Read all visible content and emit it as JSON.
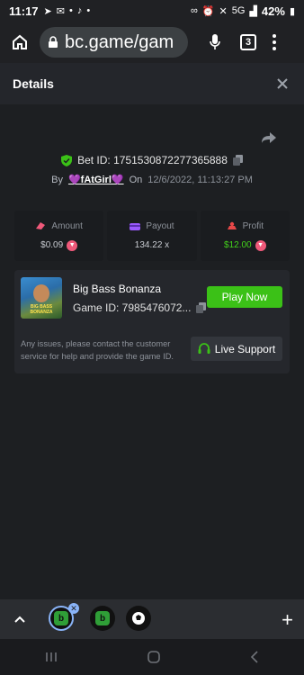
{
  "status": {
    "time": "11:17",
    "network": "5G",
    "battery": "42%"
  },
  "browser": {
    "url": "bc.game/gam",
    "tab_count": "3"
  },
  "details": {
    "title": "Details"
  },
  "bet": {
    "id_label": "Bet ID: 1751530872277365888",
    "by_label": "By",
    "user": "💜fAtGirl💜",
    "on_label": "On",
    "date": "12/6/2022, 11:13:27 PM"
  },
  "stats": {
    "amount_label": "Amount",
    "amount_value": "$0.09",
    "payout_label": "Payout",
    "payout_value": "134.22 x",
    "profit_label": "Profit",
    "profit_value": "$12.00"
  },
  "game": {
    "name": "Big Bass Bonanza",
    "id_text": "Game ID: 7985476072...",
    "thumb_text": "BIG BASS BONANZA",
    "play_label": "Play Now",
    "issue_text": "Any issues, please contact the customer service for help and provide the game ID.",
    "support_label": "Live Support"
  },
  "colors": {
    "accent_green": "#3bc117",
    "profit_green": "#43d31b",
    "coin_pink": "#f0597a"
  }
}
